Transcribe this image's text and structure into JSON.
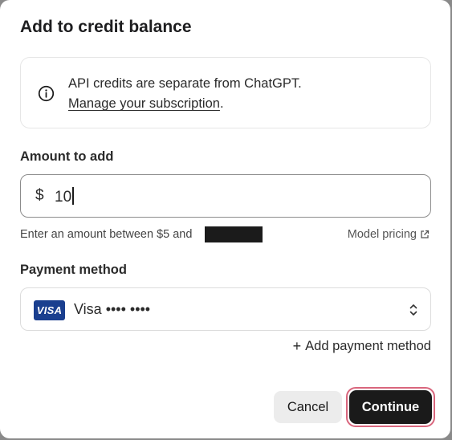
{
  "dialog": {
    "title": "Add to credit balance"
  },
  "info": {
    "icon": "info-circle-icon",
    "message": "API credits are separate from ChatGPT.",
    "link_text": "Manage your subscription",
    "link_suffix": "."
  },
  "amount": {
    "label": "Amount to add",
    "currency_symbol": "$",
    "value": "10",
    "hint": "Enter an amount between $5 and",
    "pricing_link": "Model pricing",
    "pricing_icon": "external-link-icon"
  },
  "payment": {
    "label": "Payment method",
    "card_brand_logo": "VISA",
    "card_label": "Visa •••• ••••",
    "select_icon": "chevron-up-down-icon",
    "add_label": "Add payment method",
    "add_icon": "plus-icon"
  },
  "actions": {
    "cancel_label": "Cancel",
    "continue_label": "Continue"
  },
  "colors": {
    "primary_button": "#1a1a1a",
    "focus_ring": "#d9667d",
    "visa_blue": "#1a3f8f",
    "secondary_button": "#ececec"
  }
}
